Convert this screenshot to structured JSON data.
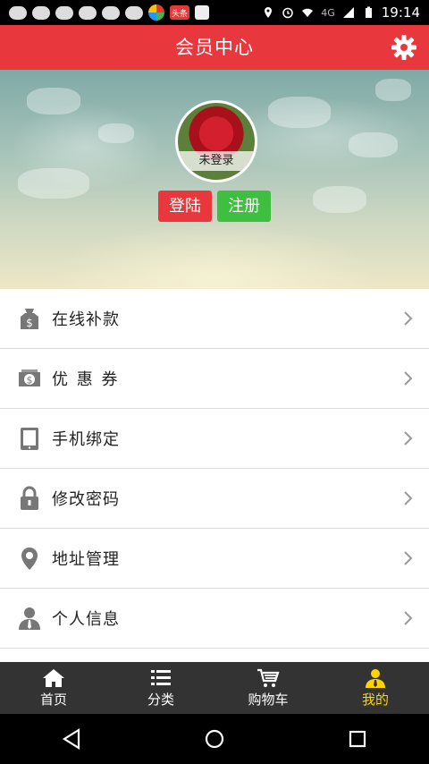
{
  "status_bar": {
    "time": "19:14",
    "network": "4G",
    "news_badge": "头条"
  },
  "header": {
    "title": "会员中心"
  },
  "profile": {
    "avatar_label": "未登录",
    "login_label": "登陆",
    "register_label": "注册"
  },
  "menu": {
    "items": [
      {
        "label": "在线补款",
        "icon": "money-bag-icon"
      },
      {
        "label": "优 惠 券",
        "icon": "coupon-icon"
      },
      {
        "label": "手机绑定",
        "icon": "tablet-icon"
      },
      {
        "label": "修改密码",
        "icon": "lock-icon"
      },
      {
        "label": "地址管理",
        "icon": "location-pin-icon"
      },
      {
        "label": "个人信息",
        "icon": "person-icon"
      }
    ]
  },
  "tabbar": {
    "tabs": [
      {
        "label": "首页",
        "icon": "home-icon"
      },
      {
        "label": "分类",
        "icon": "list-icon"
      },
      {
        "label": "购物车",
        "icon": "cart-icon"
      },
      {
        "label": "我的",
        "icon": "user-icon",
        "active": true
      }
    ]
  },
  "colors": {
    "brand_red": "#e8383d",
    "register_green": "#3fbf3f",
    "tab_active": "#ffd400",
    "tabbar_bg": "#333333"
  }
}
